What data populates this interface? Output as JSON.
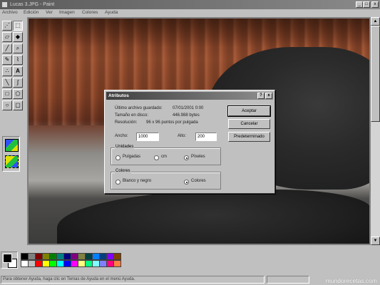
{
  "window": {
    "title": "Lucas 3.JPG - Paint",
    "minimize": "_",
    "maximize": "□",
    "close": "x"
  },
  "menu": [
    "Archivo",
    "Edición",
    "Ver",
    "Imagen",
    "Colores",
    "Ayuda"
  ],
  "tools": [
    "select-free",
    "select-rect",
    "eraser",
    "fill",
    "eyedropper",
    "magnifier",
    "pencil",
    "brush",
    "airbrush",
    "text",
    "line",
    "curve",
    "rectangle",
    "polygon",
    "ellipse",
    "rounded-rect"
  ],
  "dialog": {
    "title": "Atributos",
    "help": "?",
    "close": "x",
    "last_saved_label": "Último archivo guardado:",
    "last_saved_value": "07/01/2001 0:00",
    "disk_size_label": "Tamaño en disco:",
    "disk_size_value": "446.988 bytes",
    "resolution_label": "Resolución:",
    "resolution_value": "96 x 96 puntos por pulgada",
    "width_label": "Ancho:",
    "width_value": "1000",
    "height_label": "Alto:",
    "height_value": "200",
    "units_legend": "Unidades",
    "units": [
      "Pulgadas",
      "cm",
      "Píxeles"
    ],
    "units_selected": "Píxeles",
    "colors_legend": "Colores",
    "colors": [
      "Blanco y negro",
      "Colores"
    ],
    "colors_selected": "Colores",
    "ok_button": "Aceptar",
    "cancel_button": "Cancelar",
    "default_button": "Predeterminado"
  },
  "palette": {
    "foreground": "#000000",
    "background": "#ffffff",
    "colors": [
      "#000000",
      "#808080",
      "#800000",
      "#808000",
      "#008000",
      "#008080",
      "#000080",
      "#800080",
      "#808040",
      "#004040",
      "#0080ff",
      "#004080",
      "#8000ff",
      "#804000",
      "#ffffff",
      "#c0c0c0",
      "#ff0000",
      "#ffff00",
      "#00ff00",
      "#00ffff",
      "#0000ff",
      "#ff00ff",
      "#ffff80",
      "#00ff80",
      "#80ffff",
      "#8080ff",
      "#ff0080",
      "#ff8040"
    ]
  },
  "status": {
    "message": "Para obtener Ayuda, haga clic en Temas de Ayuda en el menú Ayuda."
  },
  "watermark": "mundorecetas.com"
}
